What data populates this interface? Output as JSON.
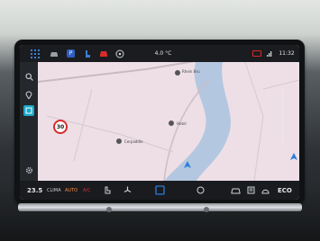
{
  "status_bar": {
    "temperature_outside": "4.0 °C",
    "time": "11:32",
    "icons": [
      "apps-grid-icon",
      "car-icon",
      "parking-icon",
      "seat-icon",
      "car-red-icon",
      "profile-circle-icon",
      "message-icon",
      "signal-icon"
    ]
  },
  "sidebar": {
    "icons": [
      "search-icon",
      "map-pin-icon",
      "map-layer-icon",
      "settings-icon"
    ]
  },
  "map": {
    "speed_limit": "30",
    "place_labels": [
      "Rhein Bru",
      "Cerpaddle",
      "Hotel"
    ],
    "colors": {
      "land": "#eedfe6",
      "water": "#b3c8e0",
      "road": "#c9b9c2",
      "position_arrow": "#2f7ed8"
    }
  },
  "bottom_bar": {
    "temperature": "23.5",
    "clima_label": "CLIMA",
    "auto_label": "AUTO",
    "ac_label": "A/C",
    "eco_label": "ECO",
    "accent_color": "#d92b2b",
    "highlight_color": "#2f7ed8",
    "icons": [
      "seat-heat-icon",
      "fan-icon",
      "home-square-icon",
      "steering-heat-icon",
      "car-mode-icon",
      "rear-defrost-icon",
      "front-defrost-icon"
    ]
  }
}
